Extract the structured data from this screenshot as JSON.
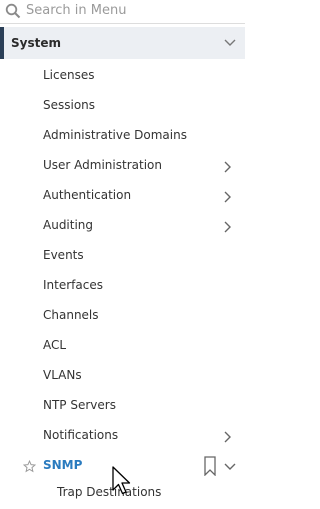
{
  "search": {
    "placeholder": "Search in Menu"
  },
  "section": {
    "label": "System"
  },
  "items": [
    {
      "label": "Licenses"
    },
    {
      "label": "Sessions"
    },
    {
      "label": "Administrative Domains"
    },
    {
      "label": "User Administration",
      "expandable": true
    },
    {
      "label": "Authentication",
      "expandable": true
    },
    {
      "label": "Auditing",
      "expandable": true
    },
    {
      "label": "Events"
    },
    {
      "label": "Interfaces"
    },
    {
      "label": "Channels"
    },
    {
      "label": "ACL"
    },
    {
      "label": "VLANs"
    },
    {
      "label": "NTP Servers"
    },
    {
      "label": "Notifications",
      "expandable": true
    }
  ],
  "active_item": {
    "label": "SNMP"
  },
  "sub_items": [
    {
      "label": "Trap Destinations"
    }
  ],
  "colors": {
    "accent": "#2a7bbf",
    "section_bar": "#2b3f57",
    "section_bg": "#eceff3"
  }
}
